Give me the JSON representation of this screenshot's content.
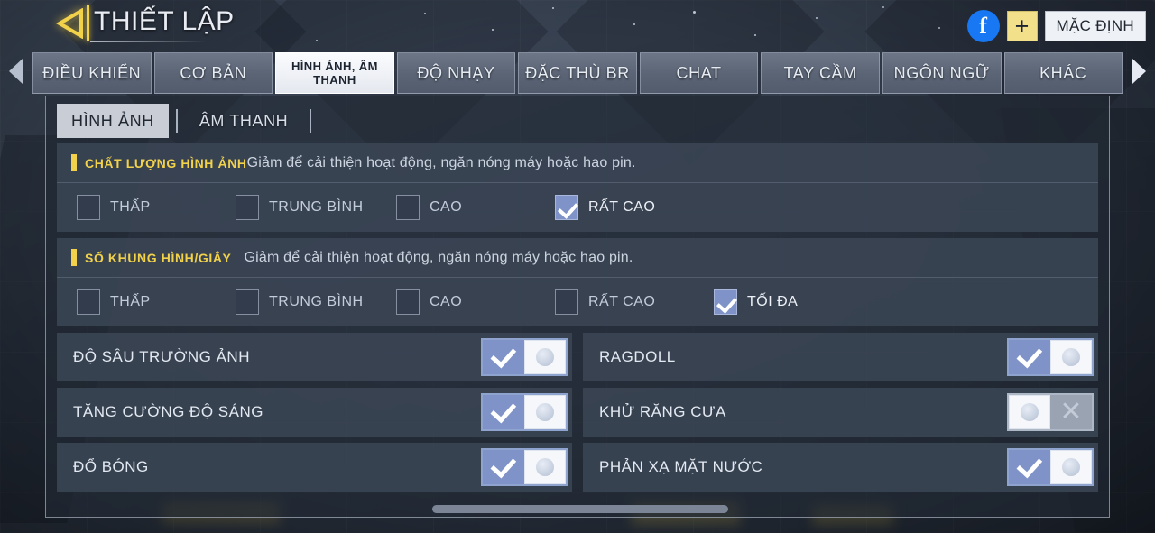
{
  "header": {
    "title": "THIẾT LẬP",
    "back_icon": "back-arrow-icon",
    "facebook_icon": "facebook-icon",
    "facebook_glyph": "f",
    "add_icon": "plus-icon",
    "add_glyph": "+",
    "default_button": "MẶC ĐỊNH"
  },
  "tabbar": {
    "left_arrow": "chevron-left-icon",
    "right_arrow": "chevron-right-icon",
    "tabs": [
      {
        "label": "ĐIỀU KHIỂN",
        "active": false
      },
      {
        "label": "CƠ BẢN",
        "active": false
      },
      {
        "label": "HÌNH ẢNH, ÂM THANH",
        "active": true
      },
      {
        "label": "ĐỘ NHẠY",
        "active": false
      },
      {
        "label": "ĐẶC THÙ BR",
        "active": false
      },
      {
        "label": "CHAT",
        "active": false
      },
      {
        "label": "TAY CẦM",
        "active": false
      },
      {
        "label": "NGÔN NGỮ",
        "active": false
      },
      {
        "label": "KHÁC",
        "active": false
      }
    ]
  },
  "subtabs": [
    {
      "label": "HÌNH ẢNH",
      "active": true
    },
    {
      "label": "ÂM THANH",
      "active": false
    }
  ],
  "sections": [
    {
      "label": "CHẤT LƯỢNG HÌNH ẢNH",
      "desc": "Giảm để cải thiện hoạt động, ngăn nóng máy hoặc hao pin.",
      "gap": "tight",
      "options": [
        {
          "label": "THẤP",
          "checked": false
        },
        {
          "label": "TRUNG BÌNH",
          "checked": false
        },
        {
          "label": "CAO",
          "checked": false
        },
        {
          "label": "RẤT CAO",
          "checked": true
        }
      ]
    },
    {
      "label": "SỐ KHUNG HÌNH/GIÂY",
      "desc": "Giảm để cải thiện hoạt động, ngăn nóng máy hoặc hao pin.",
      "gap": "loose",
      "options": [
        {
          "label": "THẤP",
          "checked": false
        },
        {
          "label": "TRUNG BÌNH",
          "checked": false
        },
        {
          "label": "CAO",
          "checked": false
        },
        {
          "label": "RẤT CAO",
          "checked": false
        },
        {
          "label": "TỐI ĐA",
          "checked": true
        }
      ]
    }
  ],
  "toggles": [
    {
      "label": "ĐỘ SÂU TRƯỜNG ẢNH",
      "on": true
    },
    {
      "label": "RAGDOLL",
      "on": true
    },
    {
      "label": "TĂNG CƯỜNG ĐỘ SÁNG",
      "on": true
    },
    {
      "label": "KHỬ RĂNG CƯA",
      "on": false
    },
    {
      "label": "ĐỔ BÓNG",
      "on": true
    },
    {
      "label": "PHẢN XẠ MẶT NƯỚC",
      "on": true
    }
  ],
  "colors": {
    "accent_yellow": "#f2d24a",
    "toggle_on_blue": "#7f93c8",
    "toggle_off_gray": "#9aa3b2",
    "panel_bg": "#3a4454",
    "facebook_blue": "#1877f2"
  },
  "scrollbar": {
    "orientation": "horizontal"
  }
}
